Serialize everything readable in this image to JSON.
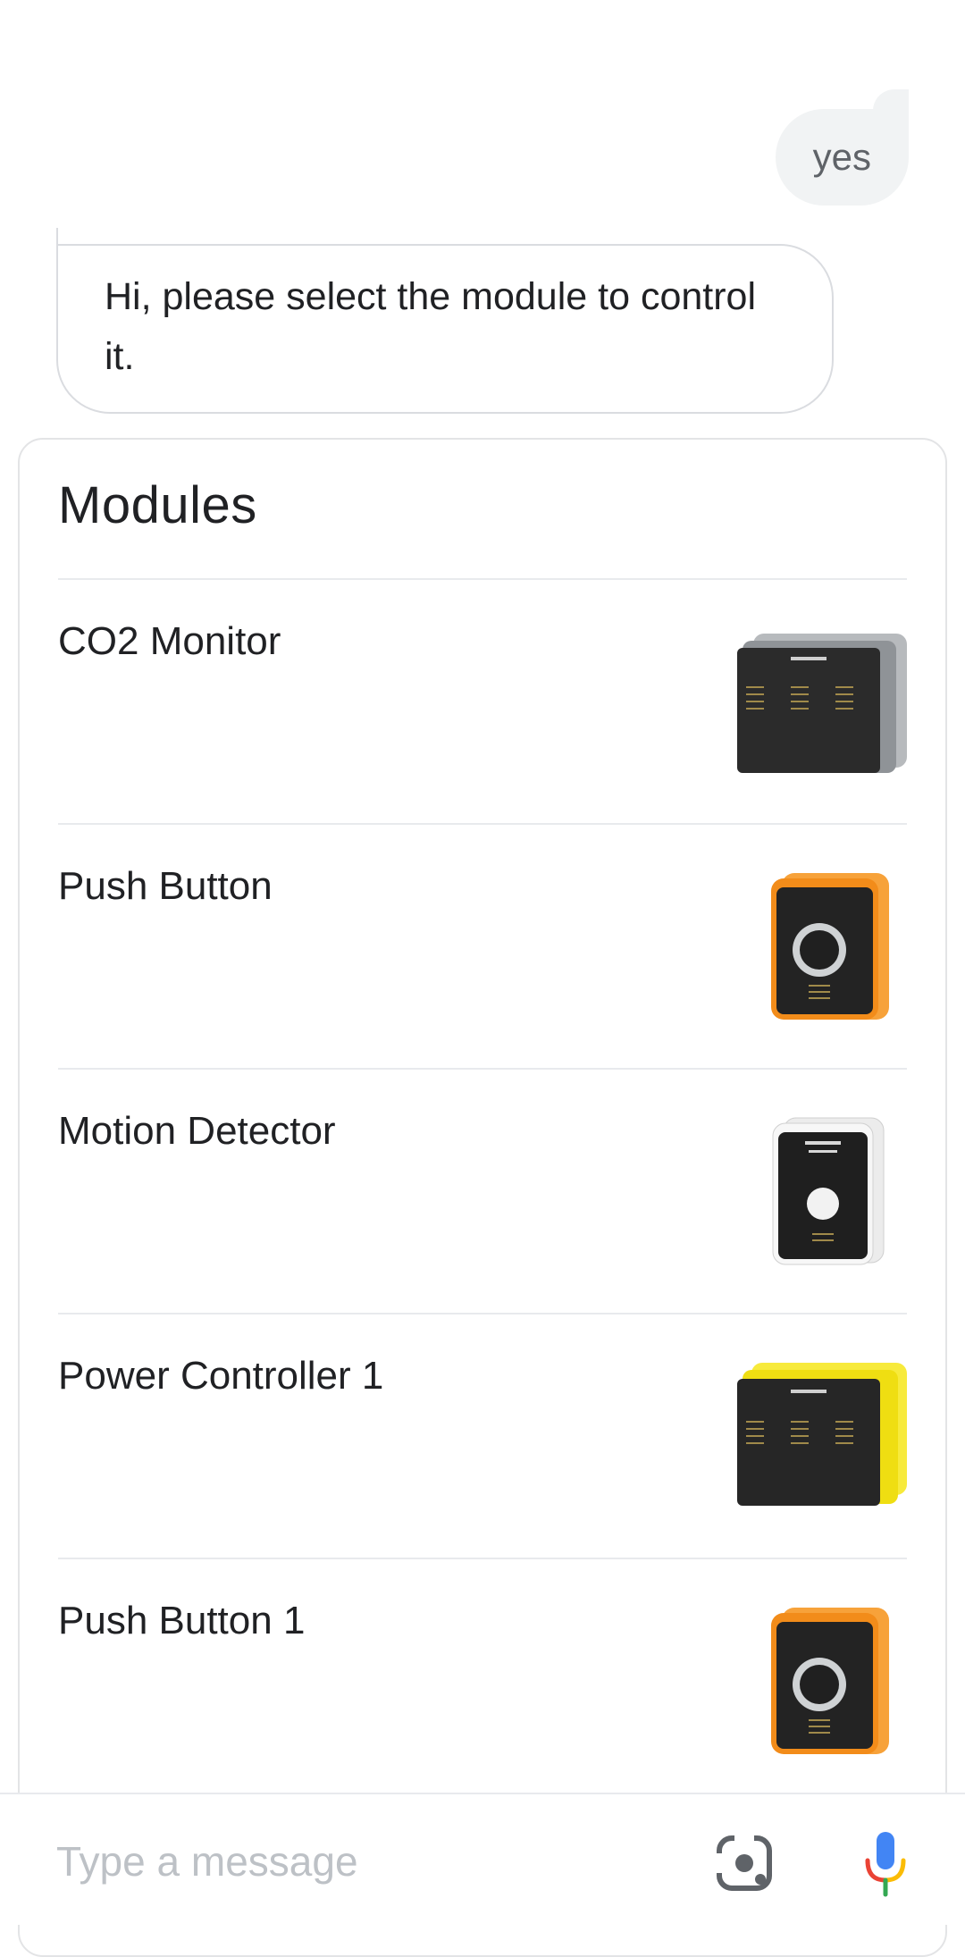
{
  "conversation": {
    "user_message": "yes",
    "assistant_message": "Hi, please select the module to control it."
  },
  "modules_card": {
    "title": "Modules",
    "items": [
      {
        "label": "CO2 Monitor",
        "image_icon": "gray-module-image",
        "color": "#9aa0a6"
      },
      {
        "label": "Push Button",
        "image_icon": "orange-push-button-image",
        "color": "#f28c1a"
      },
      {
        "label": "Motion Detector",
        "image_icon": "white-motion-sensor-image",
        "color": "#e8e8e8"
      },
      {
        "label": "Power Controller 1",
        "image_icon": "yellow-module-image",
        "color": "#f2e21a"
      },
      {
        "label": "Push Button 1",
        "image_icon": "orange-push-button-image",
        "color": "#f28c1a"
      }
    ]
  },
  "composer": {
    "placeholder": "Type a message",
    "lens_icon": "lens-icon",
    "mic_icon": "mic-icon"
  }
}
